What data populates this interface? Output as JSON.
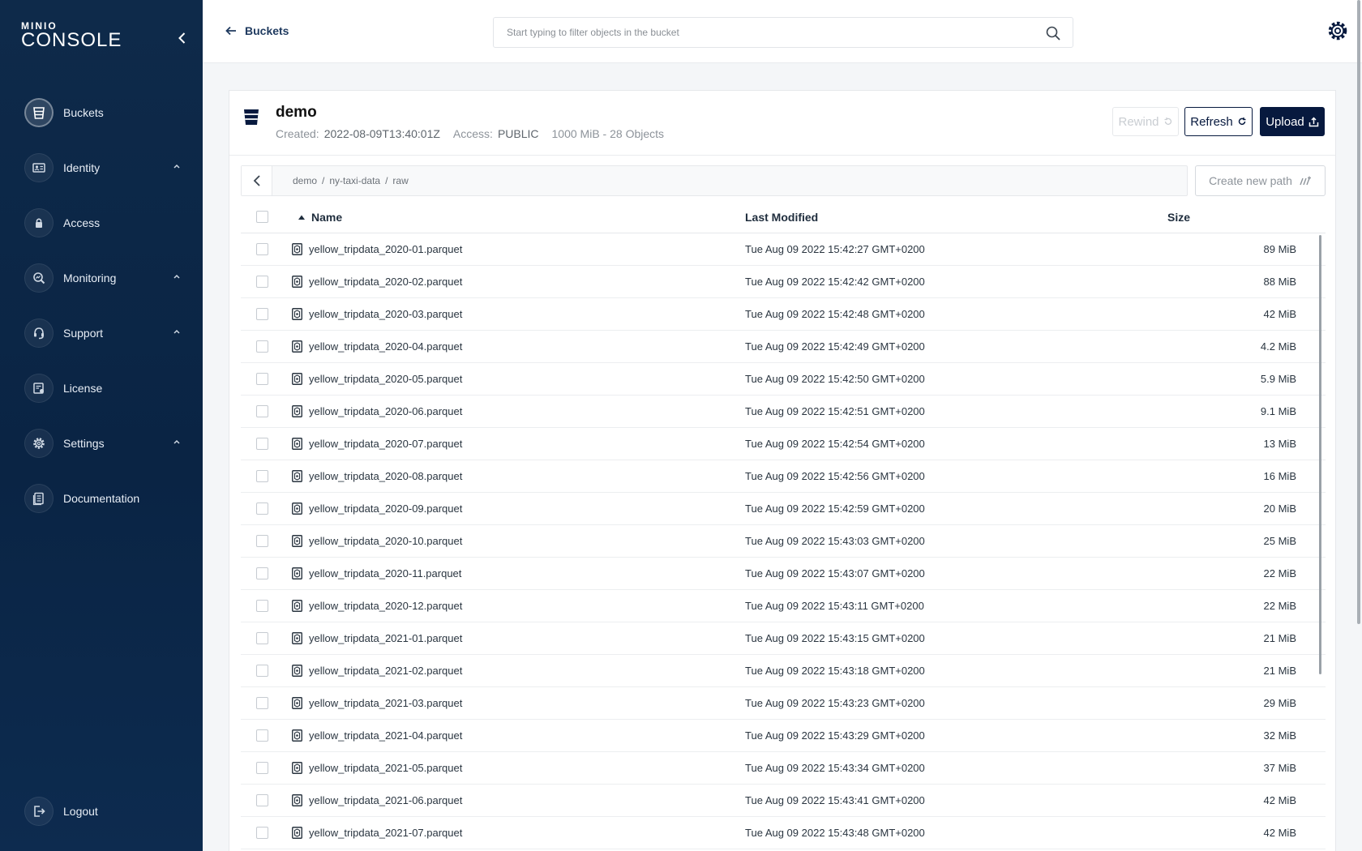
{
  "brand": {
    "mini": "MINIO",
    "console": "CONSOLE"
  },
  "nav": [
    {
      "label": "Buckets",
      "icon": "bucket-icon",
      "active": true,
      "expandable": false
    },
    {
      "label": "Identity",
      "icon": "id-card-icon",
      "active": false,
      "expandable": true
    },
    {
      "label": "Access",
      "icon": "lock-icon",
      "active": false,
      "expandable": false
    },
    {
      "label": "Monitoring",
      "icon": "search-chart-icon",
      "active": false,
      "expandable": true
    },
    {
      "label": "Support",
      "icon": "support-icon",
      "active": false,
      "expandable": true
    },
    {
      "label": "License",
      "icon": "license-icon",
      "active": false,
      "expandable": false
    },
    {
      "label": "Settings",
      "icon": "gear-icon",
      "active": false,
      "expandable": true
    },
    {
      "label": "Documentation",
      "icon": "document-icon",
      "active": false,
      "expandable": false
    }
  ],
  "logout_label": "Logout",
  "topbar": {
    "back_label": "Buckets",
    "search_placeholder": "Start typing to filter objects in the bucket"
  },
  "bucket": {
    "name": "demo",
    "created_label": "Created:",
    "created_value": "2022-08-09T13:40:01Z",
    "access_label": "Access:",
    "access_value": "PUBLIC",
    "usage": "1000 MiB - 28 Objects"
  },
  "buttons": {
    "rewind": "Rewind",
    "refresh": "Refresh",
    "upload": "Upload",
    "new_path": "Create new path"
  },
  "path": {
    "segments": [
      "demo",
      "ny-taxi-data",
      "raw"
    ],
    "separator": "/"
  },
  "table": {
    "headers": {
      "name": "Name",
      "modified": "Last Modified",
      "size": "Size"
    },
    "rows": [
      {
        "name": "yellow_tripdata_2020-01.parquet",
        "modified": "Tue Aug 09 2022 15:42:27 GMT+0200",
        "size": "89 MiB"
      },
      {
        "name": "yellow_tripdata_2020-02.parquet",
        "modified": "Tue Aug 09 2022 15:42:42 GMT+0200",
        "size": "88 MiB"
      },
      {
        "name": "yellow_tripdata_2020-03.parquet",
        "modified": "Tue Aug 09 2022 15:42:48 GMT+0200",
        "size": "42 MiB"
      },
      {
        "name": "yellow_tripdata_2020-04.parquet",
        "modified": "Tue Aug 09 2022 15:42:49 GMT+0200",
        "size": "4.2 MiB"
      },
      {
        "name": "yellow_tripdata_2020-05.parquet",
        "modified": "Tue Aug 09 2022 15:42:50 GMT+0200",
        "size": "5.9 MiB"
      },
      {
        "name": "yellow_tripdata_2020-06.parquet",
        "modified": "Tue Aug 09 2022 15:42:51 GMT+0200",
        "size": "9.1 MiB"
      },
      {
        "name": "yellow_tripdata_2020-07.parquet",
        "modified": "Tue Aug 09 2022 15:42:54 GMT+0200",
        "size": "13 MiB"
      },
      {
        "name": "yellow_tripdata_2020-08.parquet",
        "modified": "Tue Aug 09 2022 15:42:56 GMT+0200",
        "size": "16 MiB"
      },
      {
        "name": "yellow_tripdata_2020-09.parquet",
        "modified": "Tue Aug 09 2022 15:42:59 GMT+0200",
        "size": "20 MiB"
      },
      {
        "name": "yellow_tripdata_2020-10.parquet",
        "modified": "Tue Aug 09 2022 15:43:03 GMT+0200",
        "size": "25 MiB"
      },
      {
        "name": "yellow_tripdata_2020-11.parquet",
        "modified": "Tue Aug 09 2022 15:43:07 GMT+0200",
        "size": "22 MiB"
      },
      {
        "name": "yellow_tripdata_2020-12.parquet",
        "modified": "Tue Aug 09 2022 15:43:11 GMT+0200",
        "size": "22 MiB"
      },
      {
        "name": "yellow_tripdata_2021-01.parquet",
        "modified": "Tue Aug 09 2022 15:43:15 GMT+0200",
        "size": "21 MiB"
      },
      {
        "name": "yellow_tripdata_2021-02.parquet",
        "modified": "Tue Aug 09 2022 15:43:18 GMT+0200",
        "size": "21 MiB"
      },
      {
        "name": "yellow_tripdata_2021-03.parquet",
        "modified": "Tue Aug 09 2022 15:43:23 GMT+0200",
        "size": "29 MiB"
      },
      {
        "name": "yellow_tripdata_2021-04.parquet",
        "modified": "Tue Aug 09 2022 15:43:29 GMT+0200",
        "size": "32 MiB"
      },
      {
        "name": "yellow_tripdata_2021-05.parquet",
        "modified": "Tue Aug 09 2022 15:43:34 GMT+0200",
        "size": "37 MiB"
      },
      {
        "name": "yellow_tripdata_2021-06.parquet",
        "modified": "Tue Aug 09 2022 15:43:41 GMT+0200",
        "size": "42 MiB"
      },
      {
        "name": "yellow_tripdata_2021-07.parquet",
        "modified": "Tue Aug 09 2022 15:43:48 GMT+0200",
        "size": "42 MiB"
      }
    ]
  },
  "colors": {
    "sidebar": "#0a2444",
    "primary": "#07193e",
    "panel": "#ffffff",
    "background": "#f4f6f8"
  }
}
